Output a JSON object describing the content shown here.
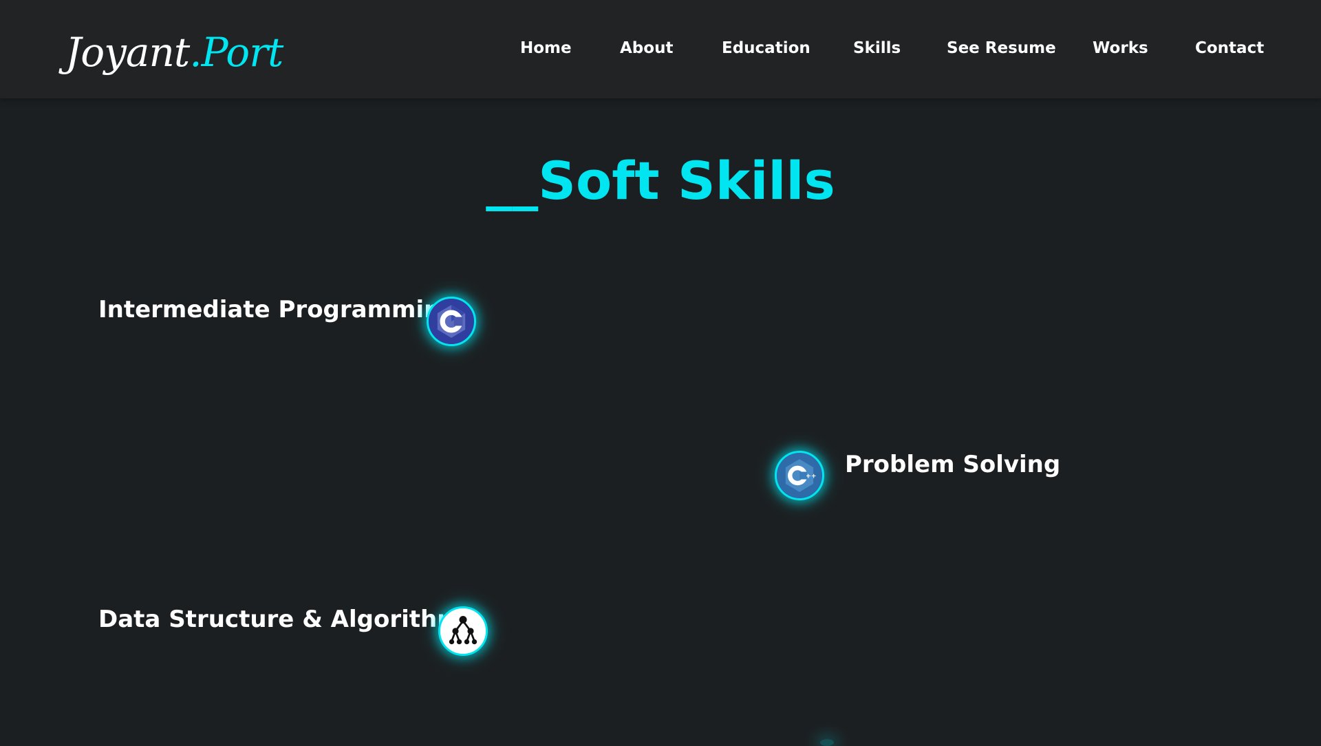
{
  "header": {
    "logo": {
      "name": "Joyant",
      "dot": ".",
      "suffix": "Port"
    },
    "nav": [
      {
        "label": "Home"
      },
      {
        "label": "About"
      },
      {
        "label": "Education"
      },
      {
        "label": "Skills"
      },
      {
        "label": "See Resume"
      },
      {
        "label": "Works"
      },
      {
        "label": "Contact"
      }
    ]
  },
  "main": {
    "title": "__Soft Skills",
    "skills": [
      {
        "label": "Intermediate Programming",
        "icon": "c-language-icon"
      },
      {
        "label": "Problem Solving",
        "icon": "cpp-language-icon"
      },
      {
        "label": "Data Structure & Algorithms",
        "icon": "tree-structure-icon"
      }
    ]
  },
  "colors": {
    "accent": "#00e5f0",
    "background": "#1c1f21",
    "navbar": "#222324",
    "text": "#ffffff"
  }
}
